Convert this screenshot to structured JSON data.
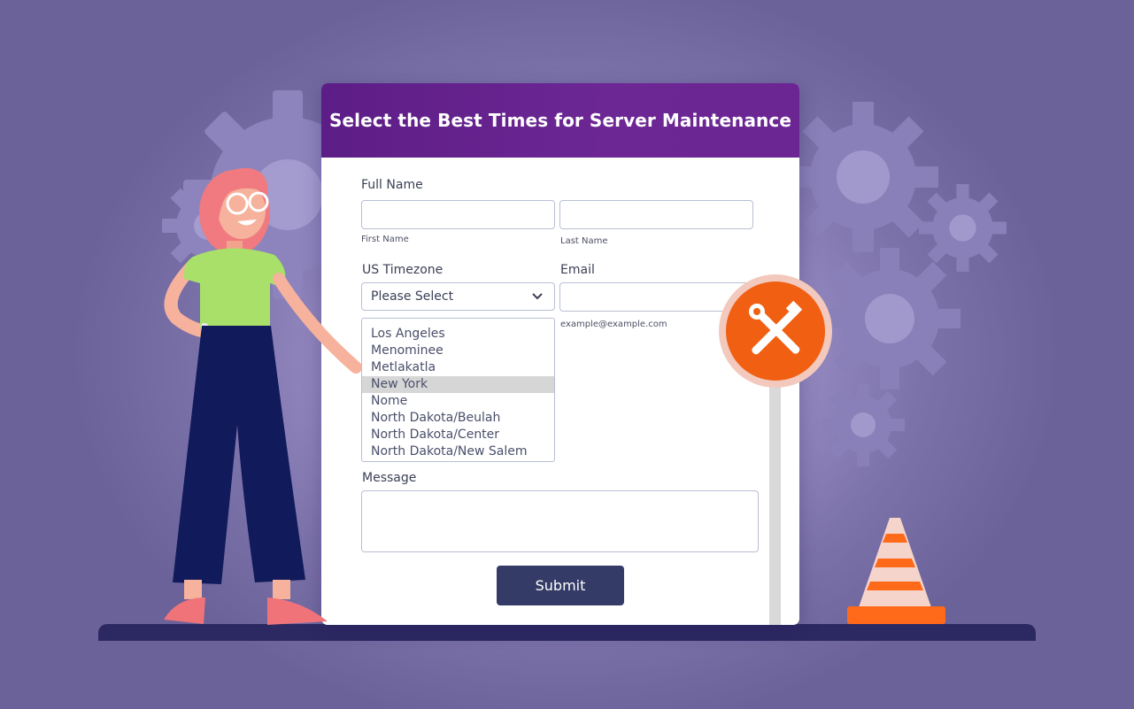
{
  "form": {
    "title": "Select the Best Times for Server Maintenance",
    "full_name": {
      "label": "Full Name",
      "first_sublabel": "First Name",
      "last_sublabel": "Last Name",
      "first_value": "",
      "last_value": ""
    },
    "timezone": {
      "label": "US Timezone",
      "selected": "Please Select",
      "options": [
        "Los Angeles",
        "Menominee",
        "Metlakatla",
        "New York",
        "Nome",
        "North Dakota/Beulah",
        "North Dakota/Center",
        "North Dakota/New Salem"
      ],
      "highlighted": "New York"
    },
    "email": {
      "label": "Email",
      "sublabel": "example@example.com",
      "value": ""
    },
    "message": {
      "label": "Message",
      "value": ""
    },
    "submit_label": "Submit"
  },
  "colors": {
    "header": "#6a2594",
    "submit": "#343b66",
    "sign_orange": "#f15f13",
    "ground": "#2c2862"
  },
  "icons": {
    "sign": "tools-icon",
    "dropdown": "chevron-down-icon"
  }
}
